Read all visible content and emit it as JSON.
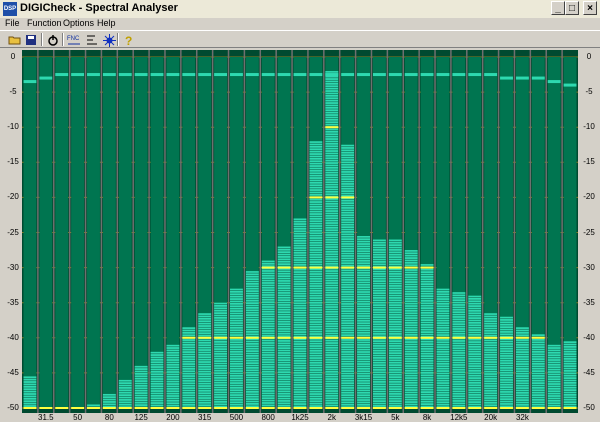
{
  "window": {
    "title": "DIGICheck - Spectral Analyser",
    "icon_label": "DSP"
  },
  "menu": [
    "File",
    "Function",
    "Options",
    "Help"
  ],
  "toolbar": [
    "open-icon",
    "save-icon",
    "power-icon",
    "fnc-icon",
    "fx-icon",
    "settings-icon",
    "help-icon"
  ],
  "toolbar_labels": {
    "fnc": "FNC"
  },
  "colors": {
    "bar_fill": "#2ed9b0",
    "bar_stripe": "#0b6b50",
    "track": "#007550",
    "grid": "#8a7a20",
    "peak": "#ffff40",
    "background": "#004a30",
    "separator": "#6f6f6f"
  },
  "chart_data": {
    "type": "bar",
    "ylim": [
      -50,
      0
    ],
    "yticks": [
      "0",
      "-5",
      "-10",
      "-15",
      "-20",
      "-25",
      "-30",
      "-35",
      "-40",
      "-45",
      "-50"
    ],
    "x_tick_labels": [
      "31.5",
      "50",
      "80",
      "125",
      "200",
      "315",
      "500",
      "800",
      "1k25",
      "2k",
      "3k15",
      "5k",
      "8k",
      "12k5",
      "20k",
      "32k"
    ],
    "levels": [
      -45.5,
      -50,
      -50,
      -50,
      -49.5,
      -48,
      -46,
      -44,
      -42,
      -41,
      -38.5,
      -36.5,
      -35,
      -33,
      -30.5,
      -29,
      -27,
      -23,
      -12,
      -2,
      -12.5,
      -25.5,
      -26,
      -26,
      -27.5,
      -29.5,
      -33,
      -33.5,
      -34,
      -36.5,
      -37,
      -38.5,
      -39.5,
      -41,
      -40.5
    ],
    "peak_hold": [
      -3.5,
      -3,
      -2.5,
      -2.5,
      -2.5,
      -2.5,
      -2.5,
      -2.5,
      -2.5,
      -2.5,
      -2.5,
      -2.5,
      -2.5,
      -2.5,
      -2.5,
      -2.5,
      -2.5,
      -2.5,
      -2.5,
      -2.5,
      -2.5,
      -2.5,
      -2.5,
      -2.5,
      -2.5,
      -2.5,
      -2.5,
      -2.5,
      -2.5,
      -2.5,
      -3,
      -3,
      -3,
      -3.5,
      -4
    ],
    "highlight_levels": [
      -10,
      -20,
      -30,
      -40,
      -50
    ]
  }
}
